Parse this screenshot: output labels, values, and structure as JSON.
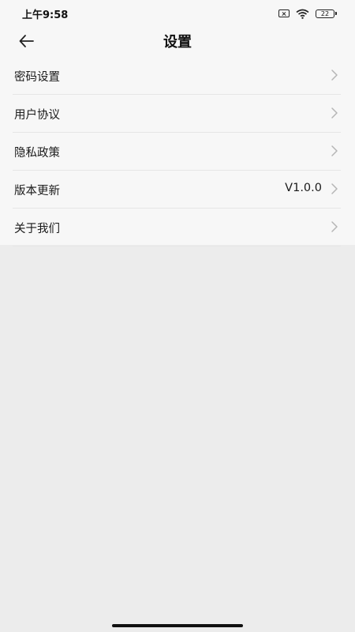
{
  "status_bar": {
    "time": "上午9:58",
    "battery": "22",
    "icons": [
      "sim-off-icon",
      "wifi-icon",
      "battery-icon"
    ]
  },
  "header": {
    "title": "设置",
    "back_icon": "arrow-left-icon"
  },
  "settings": {
    "items": [
      {
        "label": "密码设置",
        "value": ""
      },
      {
        "label": "用户协议",
        "value": ""
      },
      {
        "label": "隐私政策",
        "value": ""
      },
      {
        "label": "版本更新",
        "value": "V1.0.0"
      },
      {
        "label": "关于我们",
        "value": ""
      }
    ]
  },
  "colors": {
    "top_background": "#f7f7f7",
    "page_background": "#ececec",
    "divider": "#e6e6e6",
    "chevron": "#b5b5b5"
  }
}
